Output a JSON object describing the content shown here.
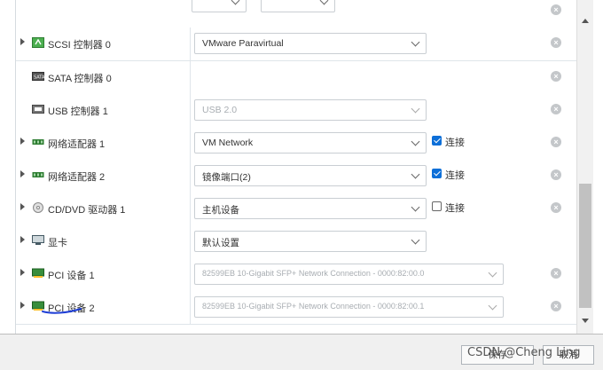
{
  "devices": [
    {
      "id": "scsi",
      "label": "SCSI 控制器 0",
      "icon": "scsi-controller-icon",
      "expandable": true,
      "select": "VMware Paravirtual",
      "disabled": false
    },
    {
      "id": "sata",
      "label": "SATA 控制器 0",
      "icon": "sata-controller-icon",
      "expandable": false
    },
    {
      "id": "usb",
      "label": "USB 控制器 1",
      "icon": "usb-controller-icon",
      "expandable": false,
      "select": "USB 2.0",
      "disabled": true
    },
    {
      "id": "net1",
      "label": "网络适配器 1",
      "icon": "network-adapter-icon",
      "expandable": true,
      "select": "VM Network",
      "disabled": false,
      "connect": true,
      "connect_label": "连接"
    },
    {
      "id": "net2",
      "label": "网络适配器 2",
      "icon": "network-adapter-icon",
      "expandable": true,
      "select": "镜像端口(2)",
      "disabled": false,
      "connect": true,
      "connect_label": "连接"
    },
    {
      "id": "cdrom",
      "label": "CD/DVD 驱动器 1",
      "icon": "cd-dvd-icon",
      "expandable": true,
      "select": "主机设备",
      "disabled": false,
      "connect": false,
      "connect_label": "连接"
    },
    {
      "id": "video",
      "label": "显卡",
      "icon": "video-card-icon",
      "expandable": true,
      "select": "默认设置",
      "disabled": false
    },
    {
      "id": "pci1",
      "label": "PCI 设备 1",
      "icon": "pci-device-icon",
      "expandable": true,
      "select": "82599EB 10-Gigabit SFP+ Network Connection - 0000:82:00.0",
      "disabled": true
    },
    {
      "id": "pci2",
      "label": "PCI 设备 2",
      "icon": "pci-device-icon",
      "expandable": true,
      "select": "82599EB 10-Gigabit SFP+ Network Connection - 0000:82:00.1",
      "disabled": true
    }
  ],
  "footer": {
    "save_label": "保存",
    "cancel_label": "取消"
  },
  "watermark": "CSDN @Cheng Ling",
  "colors": {
    "accent": "#0d6fd8",
    "remove": "#c4c7ca",
    "annotation": "#1f3fd6"
  }
}
